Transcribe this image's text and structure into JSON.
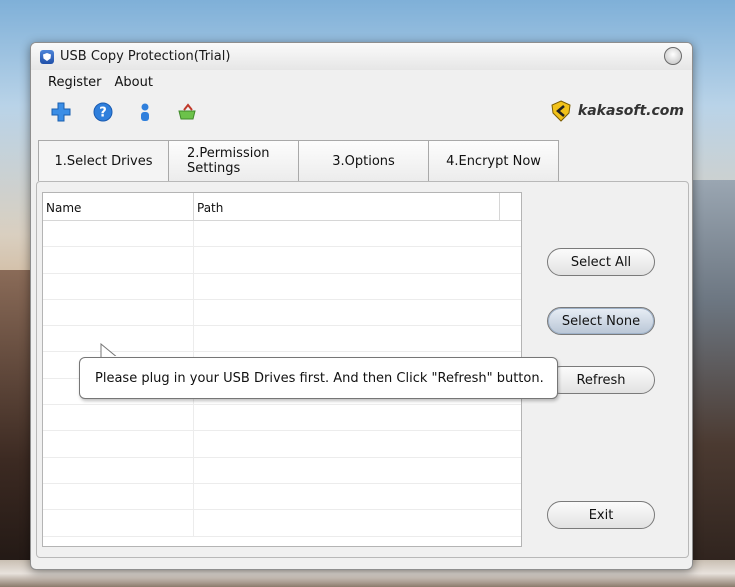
{
  "window": {
    "title": "USB Copy Protection(Trial)",
    "brand": "kakasoft.com"
  },
  "menu": {
    "items": [
      {
        "label": "Register"
      },
      {
        "label": "About"
      }
    ]
  },
  "toolbar": {
    "icons": [
      "add-icon",
      "help-icon",
      "user-icon",
      "basket-icon"
    ]
  },
  "tabs": [
    {
      "label": "1.Select Drives",
      "active": true
    },
    {
      "label": "2.Permission Settings",
      "active": false
    },
    {
      "label": "3.Options",
      "active": false
    },
    {
      "label": "4.Encrypt Now",
      "active": false
    }
  ],
  "drives_table": {
    "columns": [
      "Name",
      "Path"
    ],
    "rows": []
  },
  "buttons": {
    "select_all": "Select All",
    "select_none": "Select None",
    "refresh": "Refresh",
    "exit": "Exit"
  },
  "tooltip": {
    "text": "Please plug in your USB Drives first. And then Click \"Refresh\" button."
  },
  "colors": {
    "accent_blue": "#1f6fd6",
    "window_bg": "#f0f0f0"
  }
}
